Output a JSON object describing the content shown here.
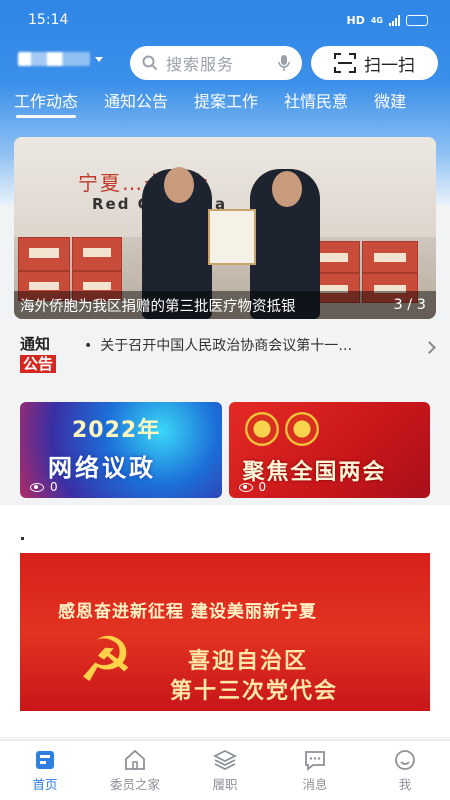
{
  "status_bar": {
    "time": "15:14",
    "hd": "HD",
    "network": "4G",
    "battery_level": 0.75
  },
  "header": {
    "location": "",
    "search_placeholder": "搜索服务",
    "scan_label": "扫一扫"
  },
  "tabs": [
    {
      "label": "工作动态",
      "active": true
    },
    {
      "label": "通知公告",
      "active": false
    },
    {
      "label": "提案工作",
      "active": false
    },
    {
      "label": "社情民意",
      "active": false
    },
    {
      "label": "微建",
      "active": false
    }
  ],
  "banner": {
    "wall_text_1": "宁夏…十字会",
    "wall_text_2": "Red C…f N…a",
    "caption": "海外侨胞为我区捐赠的第三批医疗物资抵银",
    "pager": "3 / 3"
  },
  "notice": {
    "logo_top": "通知",
    "logo_bottom": "公告",
    "text": "关于召开中国人民政治协商会议第十一…"
  },
  "tiles": [
    {
      "year": "2022年",
      "title": "网络议政",
      "views": "0"
    },
    {
      "title": "聚焦全国两会",
      "views": "0"
    }
  ],
  "party_banner": {
    "line1": "感恩奋进新征程  建设美丽新宁夏",
    "line2": "喜迎自治区",
    "line3": "第十三次党代会",
    "emblem": "☭"
  },
  "bottom_nav": [
    {
      "label": "首页",
      "icon": "home-icon",
      "active": true
    },
    {
      "label": "委员之家",
      "icon": "house-icon",
      "active": false
    },
    {
      "label": "履职",
      "icon": "layers-icon",
      "active": false
    },
    {
      "label": "消息",
      "icon": "message-icon",
      "active": false
    },
    {
      "label": "我",
      "icon": "smile-icon",
      "active": false
    }
  ],
  "colors": {
    "primary": "#2d7fe0",
    "red": "#d7261f"
  }
}
